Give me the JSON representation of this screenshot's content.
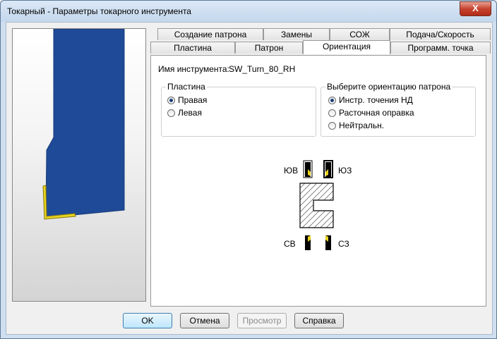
{
  "window": {
    "title": "Токарный - Параметры токарного инструмента",
    "close_label": "X"
  },
  "tabs_row1": [
    "Создание патрона",
    "Замены",
    "СОЖ",
    "Подача/Скорость"
  ],
  "tabs_row2": [
    "Пластина",
    "Патрон",
    "Ориентация",
    "Программ. точка"
  ],
  "active_tab": "Ориентация",
  "tool_name": {
    "label": "Имя инструмента:",
    "value": "SW_Turn_80_RH"
  },
  "insert_group": {
    "title": "Пластина",
    "options": [
      "Правая",
      "Левая"
    ],
    "selected": "Правая"
  },
  "holder_group": {
    "title": "Выберите ориентацию патрона",
    "options": [
      "Инстр. точения НД",
      "Расточная оправка",
      "Нейтральн."
    ],
    "selected": "Инстр. точения НД"
  },
  "orientation": {
    "tl": "ЮВ",
    "tr": "ЮЗ",
    "bl": "СВ",
    "br": "СЗ"
  },
  "buttons": {
    "ok": "OK",
    "cancel": "Отмена",
    "preview": "Просмотр",
    "help": "Справка"
  },
  "colors": {
    "tool_body": "#1f4a97",
    "insert": "#e8d21e",
    "selected_orient": "#000000"
  }
}
